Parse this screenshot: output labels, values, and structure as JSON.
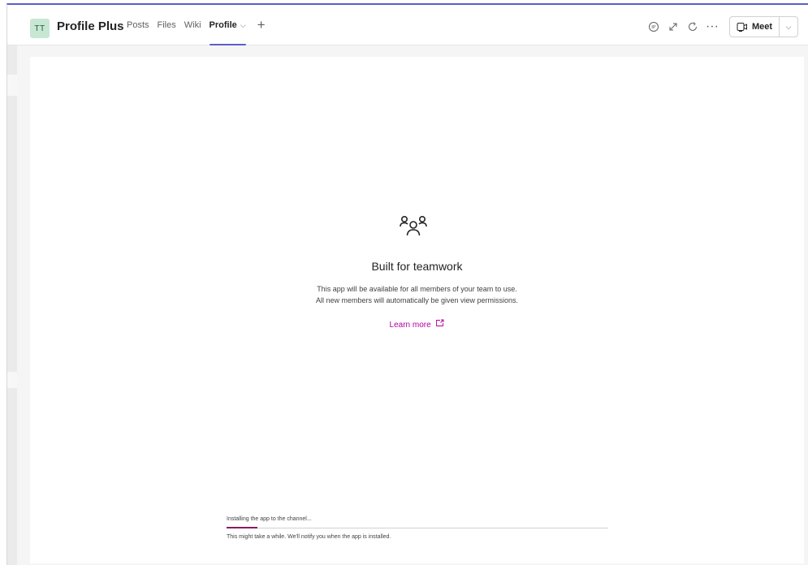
{
  "header": {
    "avatar_initials": "TT",
    "team_name": "Profile Plus",
    "tabs": [
      {
        "label": "Posts"
      },
      {
        "label": "Files"
      },
      {
        "label": "Wiki"
      },
      {
        "label": "Profile",
        "active": true
      }
    ],
    "add_tab": "+",
    "icons": [
      "conversation-icon",
      "expand-icon",
      "refresh-icon",
      "more-icon"
    ],
    "more_label": "···",
    "meet_label": "Meet"
  },
  "content": {
    "icon": "people-group-icon",
    "title": "Built for teamwork",
    "description_line1": "This app will be available for all members of your team to use.",
    "description_line2": "All new members will automatically be given view permissions.",
    "learn_more": "Learn more"
  },
  "install": {
    "status": "Installing the app to the channel...",
    "progress_percent": 8,
    "note": "This might take a while. We'll notify you when the app is installed."
  },
  "colors": {
    "accent": "#5b5fc7",
    "link": "#b4009e",
    "progress": "#8b1a5e",
    "avatar_bg": "#c8e6d4"
  }
}
